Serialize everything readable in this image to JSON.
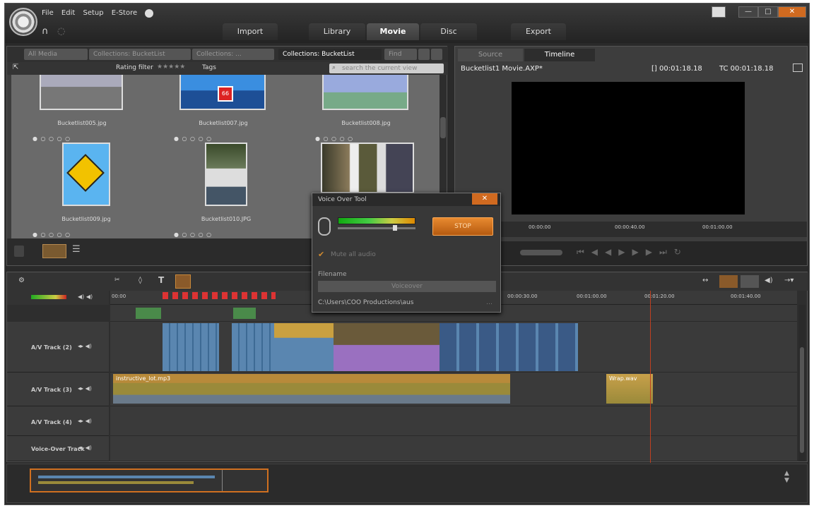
{
  "menu": {
    "file": "File",
    "edit": "Edit",
    "setup": "Setup",
    "estore": "E-Store",
    "help": "?"
  },
  "main_tabs": {
    "import": "Import",
    "library": "Library",
    "movie": "Movie",
    "disc": "Disc",
    "export": "Export"
  },
  "window_controls": {
    "minimize": "—",
    "maximize": "□",
    "close": "✕"
  },
  "library": {
    "crumbs": [
      "All Media",
      "Collections: BucketList",
      "Collections: ...",
      "Collections: BucketList",
      "Find"
    ],
    "rating_filter": "Rating filter",
    "rating_stars": "★★★★★",
    "tags": "Tags",
    "search_placeholder": "search the current view",
    "thumbs": [
      {
        "caption": "Bucketlist005.jpg"
      },
      {
        "caption": "Bucketlist007.jpg"
      },
      {
        "caption": "Bucketlist008.jpg"
      },
      {
        "caption": "Bucketlist009.jpg"
      },
      {
        "caption": "Bucketlist010.JPG"
      },
      {
        "caption": ""
      }
    ],
    "dots": "● ○ ○ ○ ○"
  },
  "preview": {
    "tabs": {
      "source": "Source",
      "timeline": "Timeline"
    },
    "title": "Bucketlist1 Movie.AXP*",
    "duration": "[] 00:01:18.18",
    "timecode": "TC 00:01:18.18",
    "scrub_ticks": [
      "00:00:00",
      "00:00:40.00",
      "00:01:00.00"
    ]
  },
  "voiceover": {
    "title": "Voice Over Tool",
    "stop": "STOP",
    "mute_label": "Mute all audio",
    "filename_label": "Filename",
    "filename_value": "Voiceover",
    "path": "C:\\Users\\COO Productions\\aus"
  },
  "timeline": {
    "ruler_ticks": [
      "00:00",
      "00:00:20.00",
      "00:00:30.00",
      "00:01:00.00",
      "00:01:20.00",
      "00:01:40.00"
    ],
    "tracks": [
      {
        "name": "A/V Track (2)"
      },
      {
        "name": "A/V Track (3)"
      },
      {
        "name": "A/V Track (4)"
      },
      {
        "name": "Voice-Over Track"
      }
    ],
    "audio_clip_label": "instructive_lot.mp3",
    "audio_clip2_label": "Wrap.wav"
  },
  "colors": {
    "accent_orange": "#e07a20",
    "clip_blue": "#5a86b0",
    "clip_audio": "#9a8a3a",
    "clip_purple": "#9a70c0"
  }
}
